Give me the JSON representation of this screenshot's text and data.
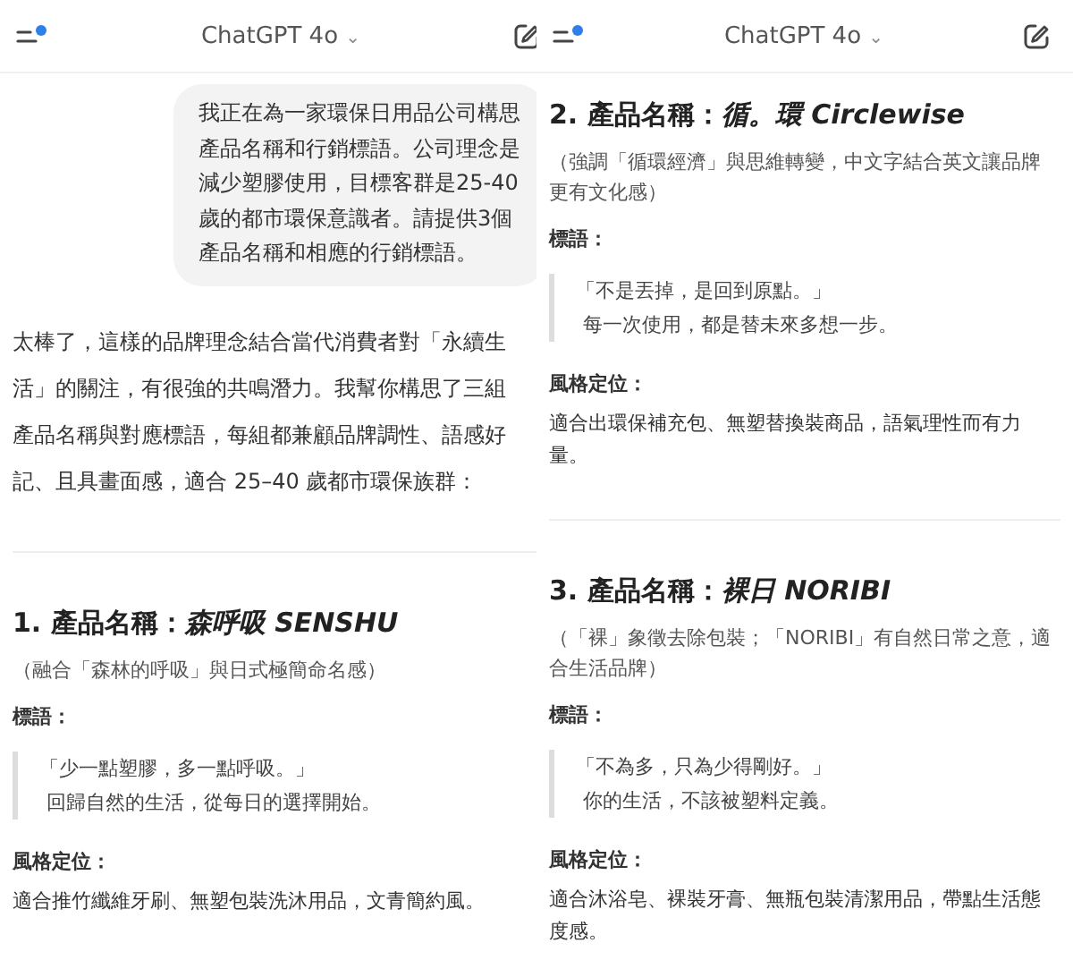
{
  "panels": [
    {
      "header": {
        "title": "ChatGPT 4o",
        "caret": "⌄"
      },
      "blocks": [
        {
          "kind": "user_message",
          "text": "我正在為一家環保日用品公司構思產品名稱和行銷標語。公司理念是減少塑膠使用，目標客群是25-40歲的都市環保意識者。請提供3個產品名稱和相應的行銷標語。"
        },
        {
          "kind": "paragraph",
          "text": "太棒了，這樣的品牌理念結合當代消費者對「永續生活」的關注，有很強的共鳴潛力。我幫你構思了三組產品名稱與對應標語，每組都兼顧品牌調性、語感好記、且具畫面感，適合 25–40 歲都市環保族群："
        },
        {
          "kind": "divider"
        },
        {
          "kind": "product",
          "heading": "1. 產品名稱：",
          "name": "森呼吸 SENSHU",
          "note": "（融合「森林的呼吸」與日式極簡命名感）",
          "slogan_label": "標語：",
          "slogan_lines": [
            "「少一點塑膠，多一點呼吸。」",
            "回歸自然的生活，從每日的選擇開始。"
          ],
          "style_label": "風格定位：",
          "style_text": "適合推竹纖維牙刷、無塑包裝洗沐用品，文青簡約風。"
        }
      ]
    },
    {
      "header": {
        "title": "ChatGPT 4o",
        "caret": "⌄"
      },
      "blocks": [
        {
          "kind": "product",
          "heading": "2. 產品名稱：",
          "name": "循。環 Circlewise",
          "note": "（強調「循環經濟」與思維轉變，中文字結合英文讓品牌更有文化感）",
          "slogan_label": "標語：",
          "slogan_lines": [
            "「不是丟掉，是回到原點。」",
            "每一次使用，都是替未來多想一步。"
          ],
          "style_label": "風格定位：",
          "style_text": "適合出環保補充包、無塑替換裝商品，語氣理性而有力量。"
        },
        {
          "kind": "divider"
        },
        {
          "kind": "product",
          "heading": "3. 產品名稱：",
          "name": "裸日 NORIBI",
          "note": "（「裸」象徵去除包裝；「NORIBI」有自然日常之意，適合生活品牌）",
          "slogan_label": "標語：",
          "slogan_lines": [
            "「不為多，只為少得剛好。」",
            "你的生活，不該被塑料定義。"
          ],
          "style_label": "風格定位：",
          "style_text": "適合沐浴皂、裸裝牙膏、無瓶包裝清潔用品，帶點生活態度感。"
        }
      ]
    }
  ]
}
